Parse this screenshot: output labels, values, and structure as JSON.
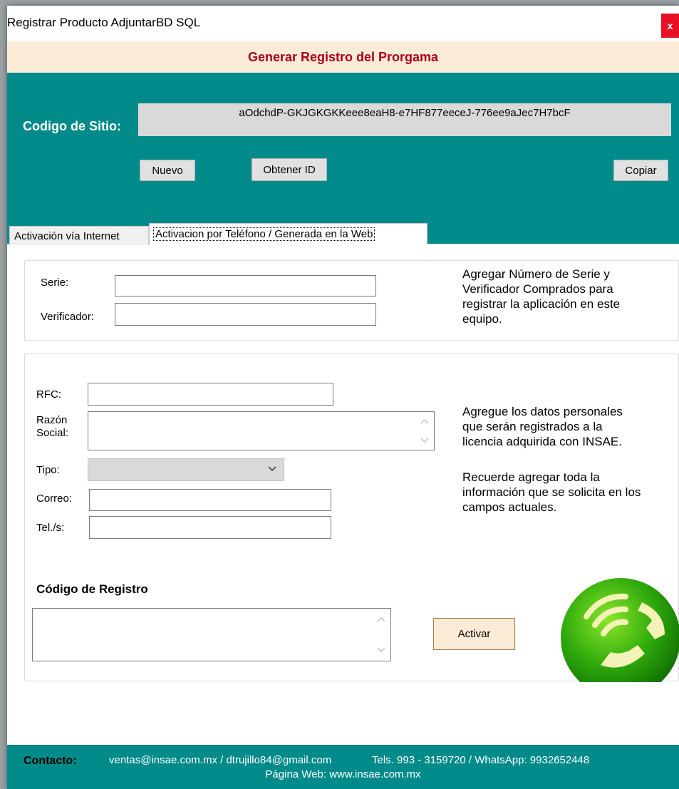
{
  "window": {
    "title": "Registrar Producto AdjuntarBD SQL",
    "close_label": "x"
  },
  "header": {
    "title": "Generar Registro del Prorgama"
  },
  "site": {
    "label": "Codigo de Sitio:",
    "code": "aOdchdP-GKJGKGKKeee8eaH8-e7HF877eeceJ-776ee9aJec7H7bcF",
    "buttons": {
      "new": "Nuevo",
      "get_id": "Obtener ID",
      "copy": "Copiar"
    }
  },
  "tabs": [
    {
      "label": "Activación vía Internet",
      "active": false
    },
    {
      "label": "Activacion por Teléfono /  Generada en la Web",
      "active": true
    }
  ],
  "serial_group": {
    "serie_label": "Serie:",
    "serie_value": "",
    "verificador_label": "Verificador:",
    "verificador_value": "",
    "description": [
      "Agregar Número de Serie y",
      "Verificador Comprados para",
      "registrar la aplicación en este",
      "equipo."
    ]
  },
  "personal_group": {
    "rfc_label": "RFC:",
    "rfc_value": "",
    "razon_label_1": "Razón",
    "razon_label_2": "Social:",
    "razon_value": "",
    "tipo_label": "Tipo:",
    "tipo_value": "",
    "correo_label": "Correo:",
    "correo_value": "",
    "tel_label": "Tel./s:",
    "tel_value": "",
    "description_1": [
      "Agregue los datos personales",
      "que serán registrados a la",
      "licencia adquirida con INSAE."
    ],
    "description_2": [
      "Recuerde agregar toda la",
      "información que se solicita en los",
      "campos actuales."
    ],
    "registro_label": "Código de Registro",
    "registro_value": "",
    "activate_button": "Activar"
  },
  "footer": {
    "contact_label": "Contacto:",
    "emails": "ventas@insae.com.mx / dtrujillo84@gmail.com",
    "phones": "Tels. 993 - 3159720 / WhatsApp: 9932652448",
    "web": "Página Web: www.insae.com.mx"
  },
  "colors": {
    "teal": "#008a8a",
    "header_band": "#fcebd7",
    "header_text": "#a8001c",
    "close": "#e81123",
    "activate_bg": "#fcebd7",
    "activate_border": "#a87a4a"
  },
  "icons": [
    "close-icon",
    "chevron-down-icon",
    "scroll-up-icon",
    "scroll-down-icon",
    "phone-logo-icon"
  ]
}
